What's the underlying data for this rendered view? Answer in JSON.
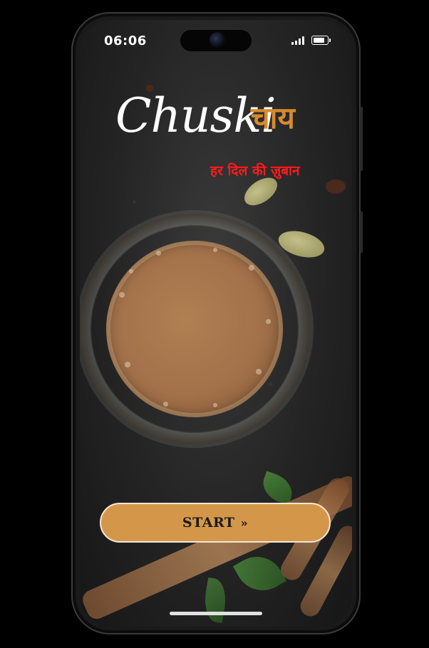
{
  "status_bar": {
    "time": "06:06"
  },
  "brand": {
    "name_script": "Chuski",
    "name_hindi": "चाय",
    "tagline": "हर दिल की ज़ुबान"
  },
  "start_button": {
    "label": "START",
    "icon": "double-arrow-right-icon",
    "icon_glyph": "»",
    "color": "#d4974a"
  },
  "colors": {
    "brand_orange": "#d78a2e",
    "tagline_red": "#ff1a1a"
  }
}
